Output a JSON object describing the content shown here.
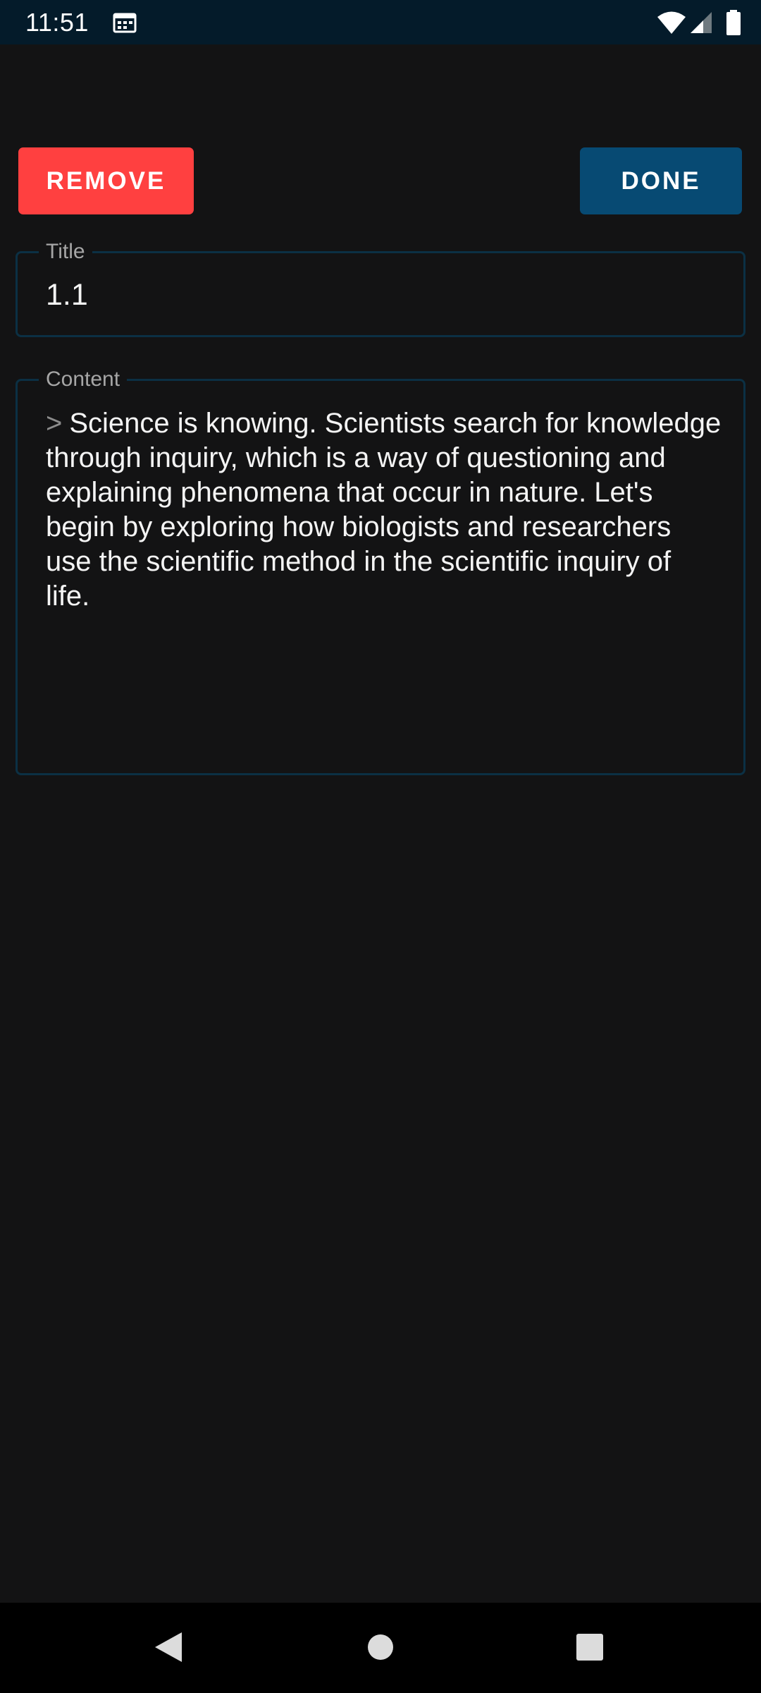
{
  "status_bar": {
    "time": "11:51",
    "icons": [
      "calendar-icon",
      "wifi-icon",
      "signal-icon",
      "battery-icon"
    ]
  },
  "toolbar": {
    "remove_label": "REMOVE",
    "done_label": "DONE"
  },
  "title_field": {
    "label": "Title",
    "value": "1.1"
  },
  "content_field": {
    "label": "Content",
    "quote_marker": ">",
    "value": "Science is knowing. Scientists search for knowledge through inquiry, which is a way of questioning and explaining phenomena that occur in nature. Let's begin by exploring how biologists and researchers use the scientific method in the scientific inquiry of life."
  },
  "nav_bar": {
    "icons": [
      "back-icon",
      "home-icon",
      "recents-icon"
    ]
  },
  "colors": {
    "background": "#131314",
    "status_bar": "#041b2a",
    "remove_button": "#ff4040",
    "done_button": "#074a73",
    "field_outline": "#0b3044"
  }
}
